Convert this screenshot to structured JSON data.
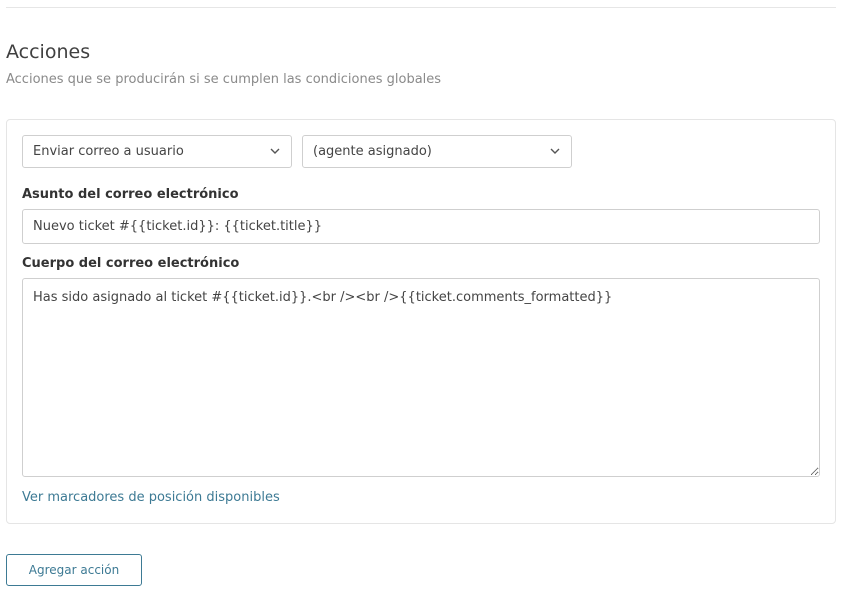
{
  "section": {
    "title": "Acciones",
    "subtitle": "Acciones que se producirán si se cumplen las condiciones globales"
  },
  "action": {
    "type_select": {
      "value": "Enviar correo a usuario",
      "icon": "chevron-down-icon"
    },
    "recipient_select": {
      "value": "(agente asignado)",
      "icon": "chevron-down-icon"
    },
    "subject": {
      "label": "Asunto del correo electrónico",
      "value": "Nuevo ticket #{{ticket.id}}: {{ticket.title}}"
    },
    "body": {
      "label": "Cuerpo del correo electrónico",
      "value": "Has sido asignado al ticket #{{ticket.id}}.<br /><br />{{ticket.comments_formatted}}"
    },
    "placeholders_link": "Ver marcadores de posición disponibles"
  },
  "buttons": {
    "add_action": "Agregar acción"
  },
  "colors": {
    "accent": "#3d7a94",
    "border": "#cfcfcf",
    "muted_text": "#8a8a8a"
  }
}
